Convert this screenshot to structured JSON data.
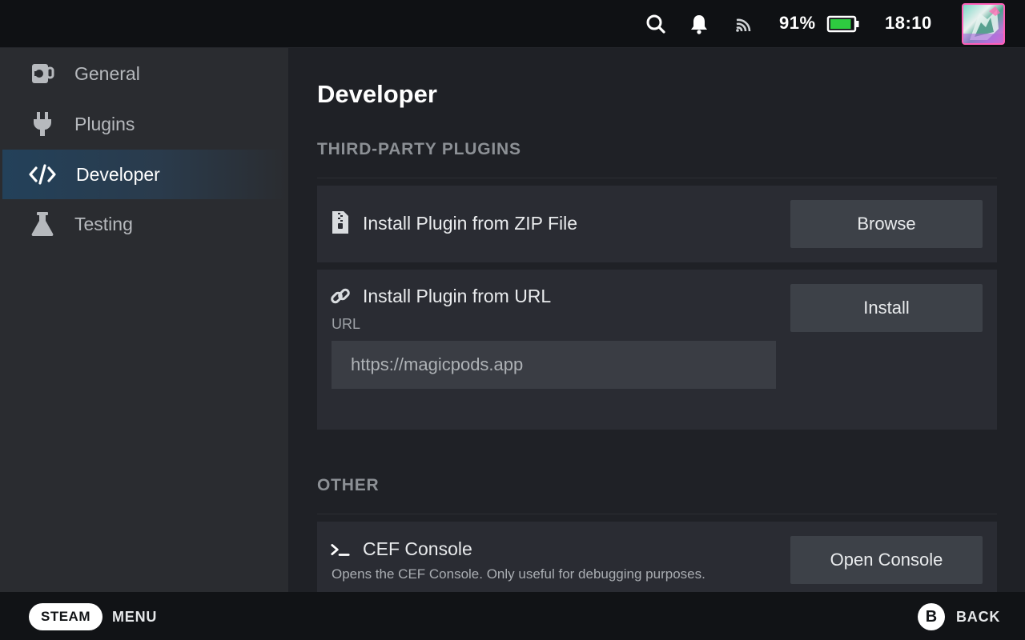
{
  "topbar": {
    "battery_percent": "91%",
    "battery_level": 0.91,
    "time": "18:10",
    "icons": [
      "search-icon",
      "bell-icon",
      "network-icon",
      "battery-icon"
    ]
  },
  "sidebar": {
    "items": [
      {
        "label": "General",
        "icon": "coffee-mug-icon",
        "active": false
      },
      {
        "label": "Plugins",
        "icon": "plug-icon",
        "active": false
      },
      {
        "label": "Developer",
        "icon": "code-icon",
        "active": true
      },
      {
        "label": "Testing",
        "icon": "flask-icon",
        "active": false
      }
    ]
  },
  "main": {
    "title": "Developer",
    "sections": {
      "third_party": {
        "heading": "THIRD-PARTY PLUGINS",
        "zip_row": {
          "label": "Install Plugin from ZIP File",
          "icon": "zip-file-icon",
          "button": "Browse"
        },
        "url_row": {
          "label": "Install Plugin from URL",
          "icon": "link-icon",
          "field_label": "URL",
          "value": "https://magicpods.app",
          "button": "Install"
        }
      },
      "other": {
        "heading": "OTHER",
        "cef_row": {
          "label": "CEF Console",
          "icon": "terminal-icon",
          "description": "Opens the CEF Console. Only useful for debugging purposes.",
          "button": "Open Console"
        }
      }
    }
  },
  "bottombar": {
    "steam_button": "STEAM",
    "menu_label": "MENU",
    "b_button": "B",
    "back_label": "BACK"
  },
  "colors": {
    "accent_active": "#23415a",
    "battery_green": "#2ecc40",
    "avatar_border": "#ff5fb8"
  }
}
